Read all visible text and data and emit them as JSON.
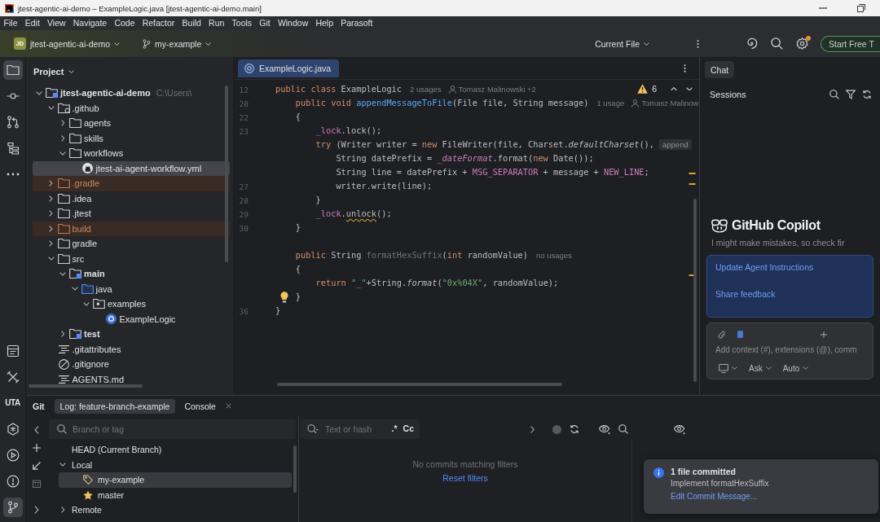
{
  "window": {
    "title": "jtest-agentic-ai-demo – ExampleLogic.java [jtest-agentic-ai-demo.main]"
  },
  "menu": [
    "File",
    "Edit",
    "View",
    "Navigate",
    "Code",
    "Refactor",
    "Build",
    "Run",
    "Tools",
    "Git",
    "Window",
    "Help",
    "Parasoft"
  ],
  "toolbar": {
    "project_badge": "JD",
    "project": "jtest-agentic-ai-demo",
    "branch": "my-example",
    "run_config": "Current File",
    "settings_badge": true,
    "trial_button": "Start Free T"
  },
  "tool_strip": {
    "top": [
      {
        "kind": "folder",
        "selected": true
      },
      {
        "kind": "commit",
        "selected": false
      },
      {
        "kind": "pull-requests",
        "selected": false
      },
      {
        "kind": "structure",
        "selected": false
      },
      {
        "kind": "more",
        "selected": false
      }
    ],
    "bottom": [
      {
        "kind": "terminal",
        "selected": false
      },
      {
        "kind": "tools",
        "selected": false
      },
      {
        "kind": "label",
        "label": "UTA",
        "selected": false
      },
      {
        "kind": "plugin",
        "selected": false
      },
      {
        "kind": "run",
        "selected": false
      },
      {
        "kind": "problems",
        "selected": false
      },
      {
        "kind": "git",
        "selected": true
      }
    ]
  },
  "project": {
    "title": "Project",
    "tree": [
      {
        "label": "jtest-agentic-ai-demo",
        "path": "C:\\Users\\",
        "kind": "module",
        "expanded": true,
        "selected": false,
        "children": [
          {
            "label": ".github",
            "kind": "github-folder",
            "expanded": true,
            "selected": false,
            "children": [
              {
                "label": "agents",
                "kind": "folder",
                "expanded": false,
                "selected": false
              },
              {
                "label": "skills",
                "kind": "folder",
                "expanded": false,
                "selected": false
              },
              {
                "label": "workflows",
                "kind": "folder",
                "expanded": true,
                "selected": false,
                "children": [
                  {
                    "label": "jtest-ai-agent-workflow.yml",
                    "kind": "workflow",
                    "selected": true
                  }
                ]
              }
            ]
          },
          {
            "label": ".gradle",
            "kind": "excluded",
            "expanded": false,
            "selected": false
          },
          {
            "label": ".idea",
            "kind": "folder",
            "expanded": false,
            "selected": false
          },
          {
            "label": ".jtest",
            "kind": "folder",
            "expanded": false,
            "selected": false
          },
          {
            "label": "build",
            "kind": "excluded",
            "expanded": false,
            "selected": false
          },
          {
            "label": "gradle",
            "kind": "folder",
            "expanded": false,
            "selected": false
          },
          {
            "label": "src",
            "kind": "folder",
            "expanded": true,
            "selected": false,
            "children": [
              {
                "label": "main",
                "kind": "source-root",
                "expanded": true,
                "selected": false,
                "children": [
                  {
                    "label": "java",
                    "kind": "source-folder",
                    "expanded": true,
                    "selected": false,
                    "children": [
                      {
                        "label": "examples",
                        "kind": "package",
                        "expanded": true,
                        "selected": false,
                        "children": [
                          {
                            "label": "ExampleLogic",
                            "kind": "class",
                            "selected": false
                          }
                        ]
                      }
                    ]
                  }
                ]
              },
              {
                "label": "test",
                "kind": "source-root",
                "expanded": false,
                "selected": false
              }
            ]
          },
          {
            "label": ".gitattributes",
            "kind": "text-file",
            "selected": false
          },
          {
            "label": ".gitignore",
            "kind": "ignore-file",
            "selected": false
          },
          {
            "label": "AGENTS.md",
            "kind": "text-file",
            "selected": false
          }
        ]
      }
    ]
  },
  "editor": {
    "tabs": [
      {
        "label": "ExampleLogic.java",
        "selected": true
      }
    ],
    "warning_count": "6",
    "lines": [
      {
        "number": "12",
        "tokens": [
          {
            "kind": "keyword",
            "text": "public class "
          },
          {
            "kind": "plain",
            "text": "ExampleLogic"
          }
        ],
        "hints": [
          {
            "kind": "usages",
            "text": "2 usages"
          },
          {
            "kind": "author",
            "text": "Tomasz Malinowski +2"
          }
        ]
      },
      {
        "number": "20",
        "tokens": [
          {
            "kind": "keyword",
            "text": "    public void "
          },
          {
            "kind": "declaration",
            "text": "appendMessageToFile"
          },
          {
            "kind": "plain",
            "text": "(File file, String message)"
          }
        ],
        "hints": [
          {
            "kind": "usages",
            "text": "1 usage"
          },
          {
            "kind": "author",
            "text": "Tomasz Malinow"
          }
        ]
      },
      {
        "number": "22",
        "tokens": [
          {
            "kind": "plain",
            "text": "    {"
          }
        ]
      },
      {
        "number": "23",
        "tokens": [
          {
            "kind": "field",
            "text": "        _lock"
          },
          {
            "kind": "plain",
            "text": ".lock();"
          }
        ]
      },
      {
        "tokens": [
          {
            "kind": "keyword",
            "text": "        try "
          },
          {
            "kind": "plain",
            "text": "(Writer writer = "
          },
          {
            "kind": "keyword",
            "text": "new "
          },
          {
            "kind": "plain",
            "text": "FileWriter(file, Charset."
          },
          {
            "kind": "static",
            "text": "defaultCharset"
          },
          {
            "kind": "plain",
            "text": "(),"
          }
        ],
        "hints": [
          {
            "kind": "parameter",
            "text": "append"
          }
        ]
      },
      {
        "tokens": [
          {
            "kind": "plain",
            "text": "            String datePrefix = "
          },
          {
            "kind": "static-field",
            "text": "_dateFormat"
          },
          {
            "kind": "plain",
            "text": ".format("
          },
          {
            "kind": "keyword",
            "text": "new "
          },
          {
            "kind": "plain",
            "text": "Date());"
          }
        ]
      },
      {
        "tokens": [
          {
            "kind": "plain",
            "text": "            String line = datePrefix + "
          },
          {
            "kind": "constant",
            "text": "MSG_SEPARATOR"
          },
          {
            "kind": "plain",
            "text": " + message + "
          },
          {
            "kind": "constant",
            "text": "NEW_LINE"
          },
          {
            "kind": "plain",
            "text": ";"
          }
        ]
      },
      {
        "number": "27",
        "tokens": [
          {
            "kind": "plain",
            "text": "            writer.write(line);"
          }
        ]
      },
      {
        "number": "28",
        "tokens": [
          {
            "kind": "plain",
            "text": "        }"
          }
        ]
      },
      {
        "number": "29",
        "tokens": [
          {
            "kind": "field",
            "text": "        _lock"
          },
          {
            "kind": "plain",
            "text": "."
          },
          {
            "kind": "warning",
            "text": "unlock"
          },
          {
            "kind": "plain",
            "text": "();"
          }
        ]
      },
      {
        "number": "30",
        "tokens": [
          {
            "kind": "plain",
            "text": "    }"
          }
        ]
      },
      {
        "blank_before": true,
        "tokens": [
          {
            "kind": "keyword",
            "text": "    public "
          },
          {
            "kind": "plain",
            "text": "String "
          },
          {
            "kind": "unused",
            "text": "formatHexSuffix"
          },
          {
            "kind": "plain",
            "text": "("
          },
          {
            "kind": "keyword",
            "text": "int "
          },
          {
            "kind": "plain",
            "text": "randomValue)"
          }
        ],
        "hints": [
          {
            "kind": "usages",
            "text": "no usages"
          }
        ]
      },
      {
        "tokens": [
          {
            "kind": "plain",
            "text": "    {"
          }
        ]
      },
      {
        "tokens": [
          {
            "kind": "keyword",
            "text": "        return "
          },
          {
            "kind": "string",
            "text": "\"_\""
          },
          {
            "kind": "plain",
            "text": "+String."
          },
          {
            "kind": "static",
            "text": "format"
          },
          {
            "kind": "plain",
            "text": "("
          },
          {
            "kind": "string",
            "text": "\"0x%04X\""
          },
          {
            "kind": "plain",
            "text": ", randomValue);"
          }
        ]
      },
      {
        "tokens": [
          {
            "kind": "plain",
            "text": "    }"
          }
        ],
        "bulb": true
      },
      {
        "number": "36",
        "tokens": [
          {
            "kind": "plain",
            "text": "}"
          }
        ]
      }
    ]
  },
  "chat": {
    "tabs": [
      {
        "label": "Chat",
        "selected": true
      }
    ],
    "title": "Sessions",
    "heading": "GitHub Copilot",
    "disclaimer": "I might make mistakes, so check fir",
    "links": [
      "Update Agent Instructions",
      "Share feedback"
    ],
    "input": {
      "placeholder": "Add context (#), extensions (@), comm",
      "mode": "Ask",
      "model": "Auto"
    }
  },
  "git": {
    "title": "Git",
    "tabs": [
      {
        "label": "Log: feature-branch-example",
        "selected": true,
        "closable": false
      },
      {
        "label": "Console",
        "selected": false,
        "closable": true
      }
    ],
    "branches": {
      "placeholder": "Branch or tag",
      "tree": [
        {
          "label": "HEAD (Current Branch)",
          "selected": false
        },
        {
          "label": "Local",
          "expanded": true,
          "selected": false,
          "children": [
            {
              "label": "my-example",
              "kind": "current",
              "selected": true
            },
            {
              "label": "master",
              "kind": "favorite",
              "selected": false
            }
          ]
        },
        {
          "label": "Remote",
          "expanded": false,
          "selected": false
        }
      ]
    },
    "log": {
      "placeholder": "Text or hash",
      "regex_toggle": ".*",
      "case_toggle": "Cc",
      "empty_text": "No commits matching filters",
      "reset_link": "Reset filters"
    }
  },
  "notification": {
    "title": "1 file committed",
    "message": "Implement formatHexSuffix",
    "link": "Edit Commit Message..."
  }
}
